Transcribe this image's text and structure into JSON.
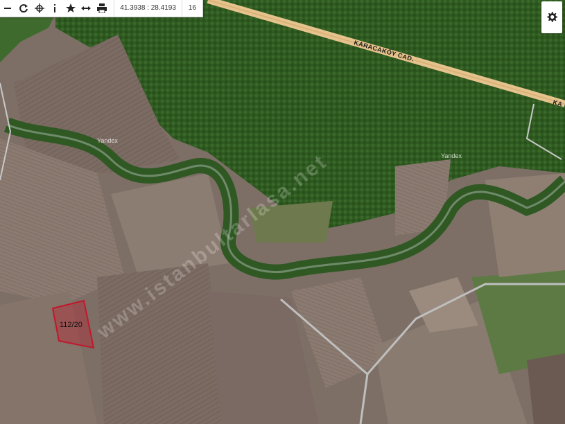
{
  "toolbar": {
    "icons": [
      "minus-icon",
      "refresh-icon",
      "locate-icon",
      "info-icon",
      "star-icon",
      "measure-icon",
      "print-icon"
    ],
    "coordinates": "41.3938 : 28.4193",
    "zoom": "16"
  },
  "map": {
    "road_label_1": "KARACAKÖY CAD.",
    "road_label_2": "KA",
    "provider_label_1": "Yandex",
    "provider_label_2": "Yandex",
    "watermark": "www.istanbultarlasa.net",
    "parcel": {
      "label": "112/20",
      "outline_color": "#c0182b",
      "fill_color": "rgba(192,24,43,0.35)"
    }
  },
  "settings": {
    "icon": "gear-icon"
  }
}
